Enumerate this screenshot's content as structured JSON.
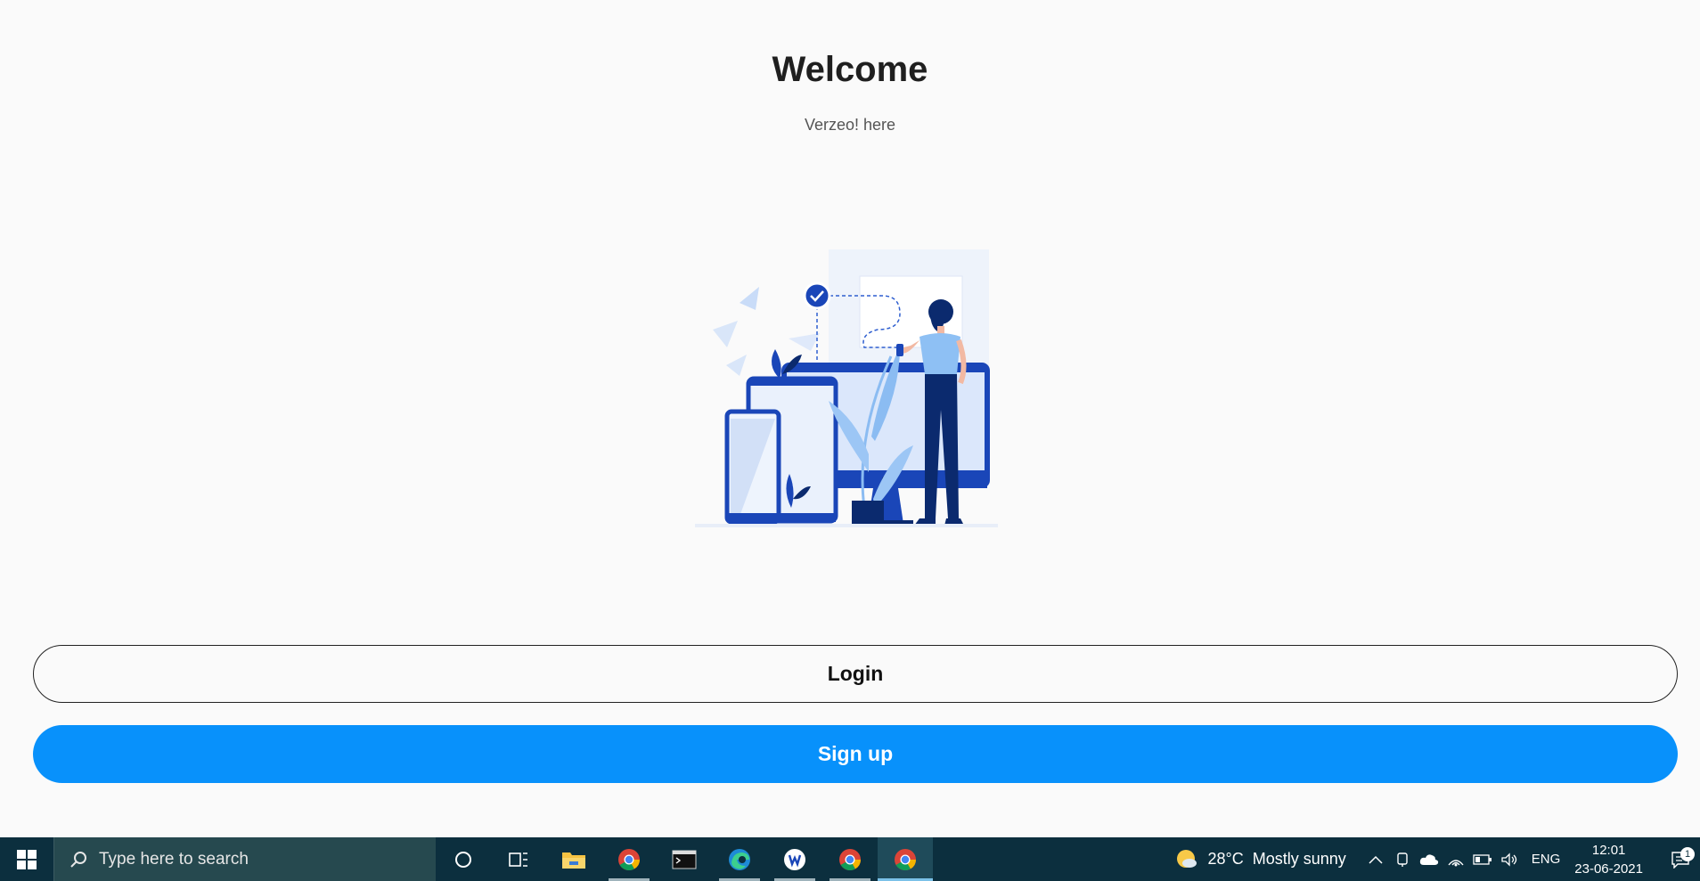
{
  "app": {
    "title": "Welcome",
    "subtitle": "Verzeo! here",
    "illustration": "person-with-devices-illustration",
    "login_label": "Login",
    "signup_label": "Sign up",
    "colors": {
      "primary": "#0891fb",
      "background": "#fafafa",
      "text": "#1f1f1f"
    }
  },
  "taskbar": {
    "search_placeholder": "Type here to search",
    "apps": [
      "cortana-icon",
      "task-view-icon",
      "file-explorer-icon",
      "chrome-icon",
      "terminal-icon",
      "edge-icon",
      "app-icon",
      "chrome-icon",
      "chrome-icon"
    ],
    "weather": {
      "temp": "28°C",
      "condition": "Mostly sunny"
    },
    "language": "ENG",
    "time": "12:01",
    "date": "23-06-2021",
    "notification_count": "1"
  }
}
